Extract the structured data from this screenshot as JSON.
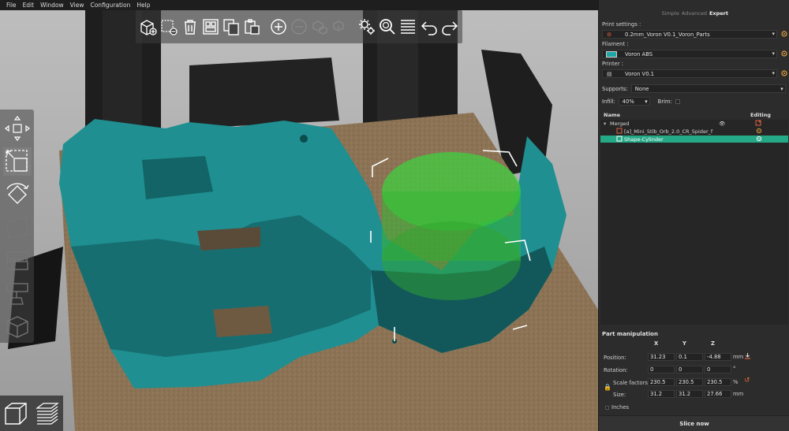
{
  "menu": [
    "File",
    "Edit",
    "Window",
    "View",
    "Configuration",
    "Help"
  ],
  "modes": {
    "simple": "Simple",
    "advanced": "Advanced",
    "expert": "Expert",
    "active": "expert"
  },
  "print_settings": {
    "label": "Print settings :",
    "value": "0.2mm_Voron V0.1_Voron_Parts"
  },
  "filament": {
    "label": "Filament :",
    "value": "Voron ABS",
    "color": "#21a6a6"
  },
  "printer": {
    "label": "Printer :",
    "value": "Voron V0.1"
  },
  "supports": {
    "label": "Supports:",
    "value": "None"
  },
  "infill": {
    "label": "Infill:",
    "value": "40%"
  },
  "brim": {
    "label": "Brim:"
  },
  "object_list": {
    "col_name": "Name",
    "col_editing": "Editing",
    "rows": [
      {
        "text": "Merged"
      },
      {
        "text": "[a]_Mini_Stlb_Orb_2.0_CR_Spider_f"
      },
      {
        "text": "Shape-Cylinder"
      }
    ]
  },
  "part_manipulation": {
    "title": "Part manipulation",
    "headers": [
      "X",
      "Y",
      "Z"
    ],
    "position": {
      "label": "Position:",
      "values": [
        "31.23",
        "0.1",
        "-4.88"
      ],
      "unit": "mm"
    },
    "rotation": {
      "label": "Rotation:",
      "values": [
        "0",
        "0",
        "0"
      ],
      "unit": "°"
    },
    "scale": {
      "label": "Scale factors:",
      "values": [
        "230.5",
        "230.5",
        "230.5"
      ],
      "unit": "%"
    },
    "size": {
      "label": "Size:",
      "values": [
        "31.2",
        "31.2",
        "27.66"
      ],
      "unit": "mm"
    },
    "inches": "Inches"
  },
  "slice_button": "Slice now",
  "colors": {
    "accent": "#25a886",
    "model": "#1f8f91",
    "modifier": "#3fcf3f",
    "bed": "#8c7356",
    "icon": "#ffffff"
  }
}
